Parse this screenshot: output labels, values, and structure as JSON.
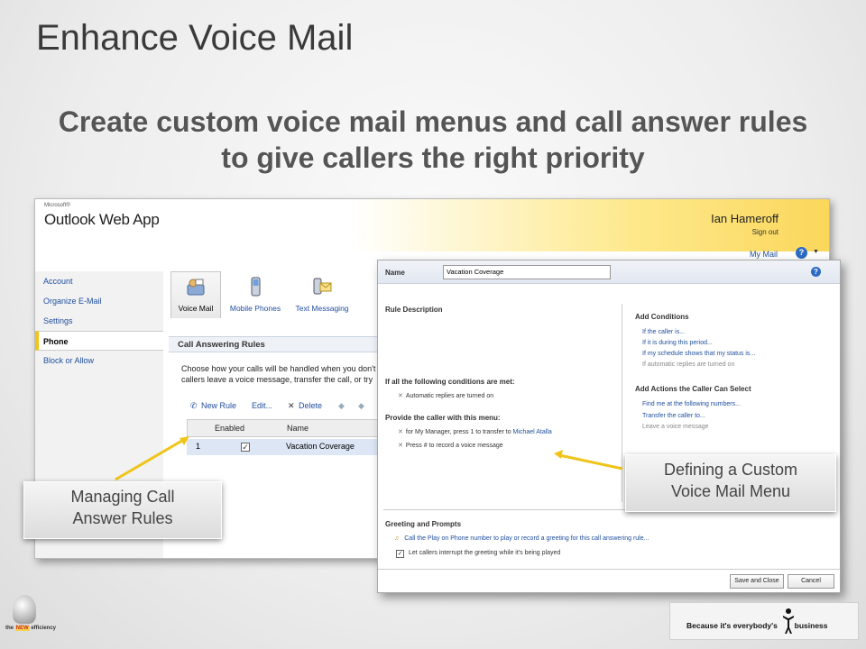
{
  "slide": {
    "title": "Enhance Voice Mail",
    "subtitle": "Create custom voice mail menus and call answer rules to give callers the right priority"
  },
  "owa": {
    "brand_small": "Microsoft®",
    "app_name": "Outlook Web App",
    "user_name": "Ian Hameroff",
    "sign_out": "Sign out",
    "my_mail": "My Mail",
    "nav": [
      "Account",
      "Organize E-Mail",
      "Settings",
      "Phone",
      "Block or Allow"
    ],
    "active_nav": "Phone",
    "tabs": [
      {
        "label": "Voice Mail",
        "icon": "voice-mail-icon"
      },
      {
        "label": "Mobile Phones",
        "icon": "mobile-phone-icon"
      },
      {
        "label": "Text Messaging",
        "icon": "text-messaging-icon"
      }
    ],
    "section_title": "Call Answering Rules",
    "section_desc_1": "Choose how your calls will be handled when you don't",
    "section_desc_2": "callers leave a voice message, transfer the call, or try",
    "toolbar": {
      "new_rule": "New Rule",
      "edit": "Edit...",
      "delete": "Delete"
    },
    "grid": {
      "headers": [
        "Enabled",
        "Name"
      ],
      "rows": [
        {
          "index": "1",
          "enabled": true,
          "name": "Vacation Coverage"
        }
      ]
    }
  },
  "dialog": {
    "name_label": "Name",
    "name_value": "Vacation Coverage",
    "rule_description": "Rule Description",
    "conditions_header": "If all the following conditions are met:",
    "condition_1": "Automatic replies are turned on",
    "menu_header": "Provide the caller with this menu:",
    "menu_1_prefix": "for My Manager, press 1 to transfer to",
    "menu_1_link": "Michael Atalla",
    "menu_2": "Press # to record a voice message",
    "add_conditions": "Add Conditions",
    "conditions_links": [
      "If the caller is...",
      "If it is during this period...",
      "If my schedule shows that my status is..."
    ],
    "conditions_disabled": "If automatic replies are turned on",
    "add_actions": "Add Actions the Caller Can Select",
    "actions_links": [
      "Find me at the following numbers...",
      "Transfer the caller to..."
    ],
    "actions_disabled": "Leave a voice message",
    "greeting_header": "Greeting and Prompts",
    "greeting_link": "Call the Play on Phone number to play or record a greeting for this call answering rule...",
    "interrupt_label": "Let callers interrupt the greeting while it's being played",
    "save_button": "Save and Close",
    "cancel_button": "Cancel"
  },
  "callouts": {
    "left_1": "Managing Call",
    "left_2": "Answer Rules",
    "right_1": "Defining a Custom",
    "right_2": "Voice Mail Menu"
  },
  "branding": {
    "left_logo_pre": "the",
    "left_logo_new": "NEW",
    "left_logo_post": "efficiency",
    "tagline_pre": "Because it's everybody's",
    "tagline_post": "business"
  },
  "colors": {
    "link": "#1f4e9e",
    "arrow": "#f0c419",
    "selected_row": "#dce6f4"
  }
}
